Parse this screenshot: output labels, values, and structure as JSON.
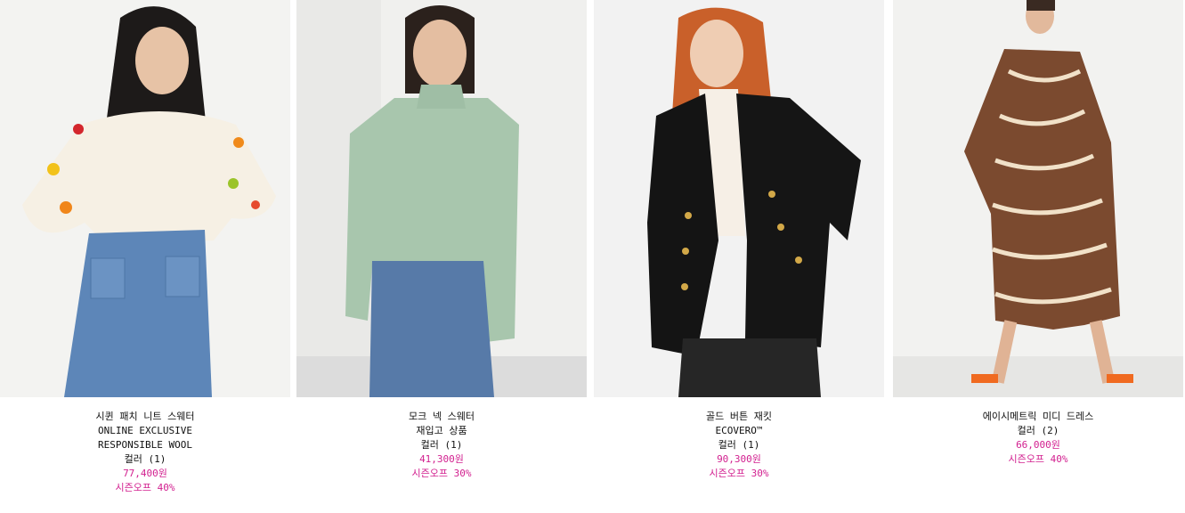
{
  "products": [
    {
      "name": "시퀸 패치 니트 스웨터",
      "tags": [
        "ONLINE EXCLUSIVE",
        "RESPONSIBLE WOOL"
      ],
      "colors": "컬러 (1)",
      "price": "77,400원",
      "sale": "시즌오프 40%",
      "image_desc": "sweater-photo"
    },
    {
      "name": "모크 넥 스웨터",
      "tags": [
        "재입고 상품"
      ],
      "colors": "컬러 (1)",
      "price": "41,300원",
      "sale": "시즌오프 30%",
      "image_desc": "sweater-photo"
    },
    {
      "name": "골드 버튼 재킷",
      "tags": [
        "ECOVERO™"
      ],
      "colors": "컬러 (1)",
      "price": "90,300원",
      "sale": "시즌오프 30%",
      "image_desc": "jacket-photo"
    },
    {
      "name": "에이시메트릭 미디 드레스",
      "tags": [],
      "colors": "컬러 (2)",
      "price": "66,000원",
      "sale": "시즌오프 40%",
      "image_desc": "dress-photo"
    }
  ],
  "colors": {
    "sale_price": "#d21f8f",
    "text": "#111111"
  }
}
